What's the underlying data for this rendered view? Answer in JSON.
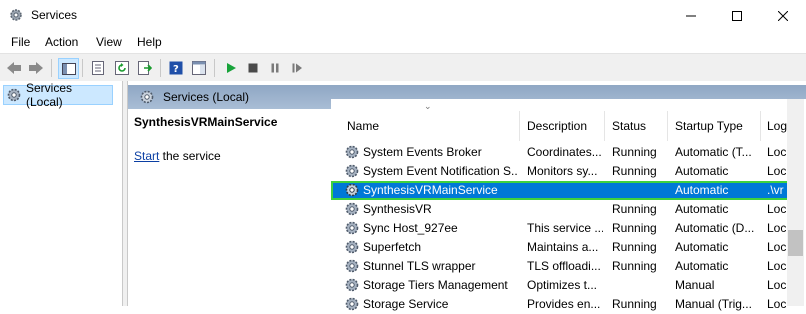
{
  "window": {
    "title": "Services"
  },
  "menu": [
    "File",
    "Action",
    "View",
    "Help"
  ],
  "tree": {
    "selected_label": "Services (Local)"
  },
  "pane": {
    "header": "Services (Local)"
  },
  "detail": {
    "service_name": "SynthesisVRMainService",
    "start_link": "Start",
    "start_suffix": " the service"
  },
  "columns": {
    "name": "Name",
    "description": "Description",
    "status": "Status",
    "startup_type": "Startup Type",
    "log_on_as": "Log"
  },
  "services": [
    {
      "name": "System Events Broker",
      "description": "Coordinates...",
      "status": "Running",
      "startup": "Automatic (T...",
      "logon": "Loc"
    },
    {
      "name": "System Event Notification S...",
      "description": "Monitors sy...",
      "status": "Running",
      "startup": "Automatic",
      "logon": "Loc"
    },
    {
      "name": "SynthesisVRMainService",
      "description": "",
      "status": "",
      "startup": "Automatic",
      "logon": ".\\vr",
      "selected": true
    },
    {
      "name": "SynthesisVR",
      "description": "",
      "status": "Running",
      "startup": "Automatic",
      "logon": "Loc"
    },
    {
      "name": "Sync Host_927ee",
      "description": "This service ...",
      "status": "Running",
      "startup": "Automatic (D...",
      "logon": "Loc"
    },
    {
      "name": "Superfetch",
      "description": "Maintains a...",
      "status": "Running",
      "startup": "Automatic",
      "logon": "Loc"
    },
    {
      "name": "Stunnel TLS wrapper",
      "description": "TLS offloadi...",
      "status": "Running",
      "startup": "Automatic",
      "logon": "Loc"
    },
    {
      "name": "Storage Tiers Management",
      "description": "Optimizes t...",
      "status": "",
      "startup": "Manual",
      "logon": "Loc"
    },
    {
      "name": "Storage Service",
      "description": "Provides en...",
      "status": "Running",
      "startup": "Manual (Trig...",
      "logon": "Loc"
    }
  ],
  "colors": {
    "selection": "#0078d7",
    "selection_outline": "#3fd13f",
    "header_band": "#9db2cd",
    "link": "#0b3fa3"
  },
  "icons": [
    "services-app-icon",
    "minimize-icon",
    "maximize-icon",
    "close-icon",
    "back-icon",
    "forward-icon",
    "console-tree-icon",
    "properties-icon",
    "refresh-icon",
    "export-list-icon",
    "help-icon",
    "show-hide-icon",
    "start-service-icon",
    "stop-service-icon",
    "pause-service-icon",
    "restart-service-icon",
    "gear-icon"
  ]
}
